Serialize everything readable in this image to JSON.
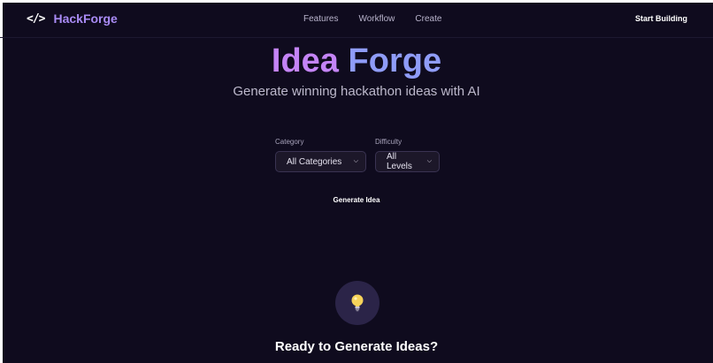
{
  "brand": {
    "icon": "code-icon",
    "icon_glyph": "</>",
    "name": "HackForge"
  },
  "nav": {
    "links": [
      "Features",
      "Workflow",
      "Create"
    ],
    "cta": "Start Building"
  },
  "hero": {
    "title_part1": "Idea",
    "title_part2": "Forge",
    "subtitle": "Generate winning hackathon ideas with AI"
  },
  "filters": {
    "category": {
      "label": "Category",
      "value": "All Categories"
    },
    "difficulty": {
      "label": "Difficulty",
      "value": "All Levels"
    }
  },
  "generate_label": "Generate Idea",
  "empty_state": {
    "icon": "lightbulb-icon",
    "title": "Ready to Generate Ideas?"
  },
  "colors": {
    "background": "#0f0b1e",
    "brand": "#a98bf5",
    "title_gradient_start": "#c484f6",
    "title_gradient_end": "#8f9cf8",
    "icon_circle": "#2b2448"
  }
}
